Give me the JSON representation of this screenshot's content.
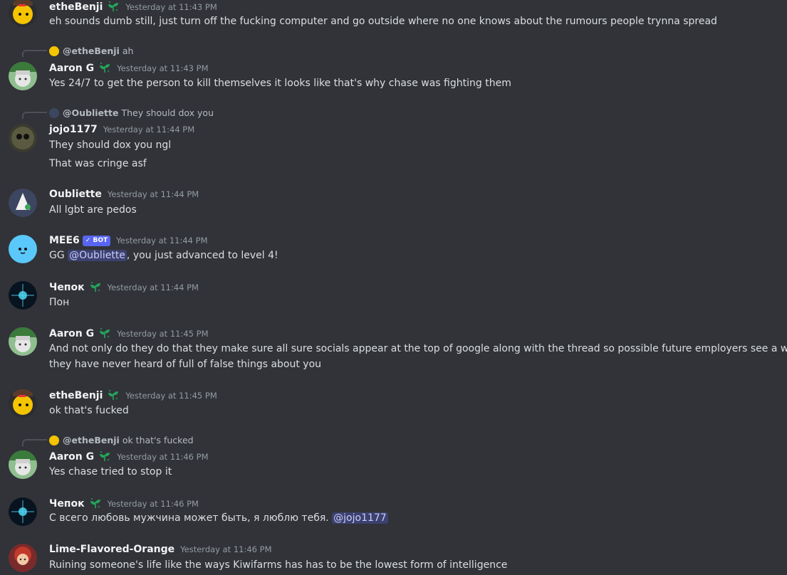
{
  "messages": [
    {
      "author": "etheBenji",
      "time": "Yesterday at 11:43 PM",
      "lines": [
        "eh sounds dumb still, just turn off the fucking computer and go outside where no one knows about the rumours people trynna spread"
      ]
    },
    {
      "reply_to": "@etheBenji",
      "reply_text": "ah",
      "author": "Aaron G",
      "time": "Yesterday at 11:43 PM",
      "lines": [
        "Yes 24/7 to get the person to kill themselves it looks like that's why chase was fighting them"
      ]
    },
    {
      "reply_to": "@Oubliette",
      "reply_text": "They should dox you",
      "author": "jojo1177",
      "time": "Yesterday at 11:44 PM",
      "lines": [
        "They should dox you ngl",
        "That was cringe asf"
      ]
    },
    {
      "author": "Oubliette",
      "time": "Yesterday at 11:44 PM",
      "lines": [
        "All lgbt are pedos"
      ]
    },
    {
      "author": "MEE6",
      "badge": "BOT",
      "time": "Yesterday at 11:44 PM",
      "text_pre": "GG ",
      "mention": "@Oubliette",
      "text_post": ", you just advanced to level 4!"
    },
    {
      "author": "Чепок",
      "time": "Yesterday at 11:44 PM",
      "lines": [
        "Пон"
      ]
    },
    {
      "author": "Aaron G",
      "time": "Yesterday at 11:45 PM",
      "lines": [
        "And not only do they do that they make sure all sure socials appear at the top of google along with the thread so possible future employers see a website",
        "they have never heard of full of false things about you"
      ]
    },
    {
      "author": "etheBenji",
      "time": "Yesterday at 11:45 PM",
      "lines": [
        "ok that's fucked"
      ]
    },
    {
      "reply_to": "@etheBenji",
      "reply_text": "ok that's fucked",
      "author": "Aaron G",
      "time": "Yesterday at 11:46 PM",
      "lines": [
        "Yes chase tried to stop it"
      ]
    },
    {
      "author": "Чепок",
      "time": "Yesterday at 11:46 PM",
      "text_pre": "С всего любовь мужчина может быть, я люблю тебя. ",
      "mention": "@jojo1177",
      "text_post": ""
    },
    {
      "author": "Lime-Flavored-Orange",
      "time": "Yesterday at 11:46 PM",
      "lines": [
        "Ruining someone's life like the ways Kiwifarms has has to be the lowest form of intelligence"
      ]
    }
  ],
  "colors": {
    "background": "#313338",
    "mention_bg": "#5865f2",
    "leaf": "#23a55a"
  }
}
